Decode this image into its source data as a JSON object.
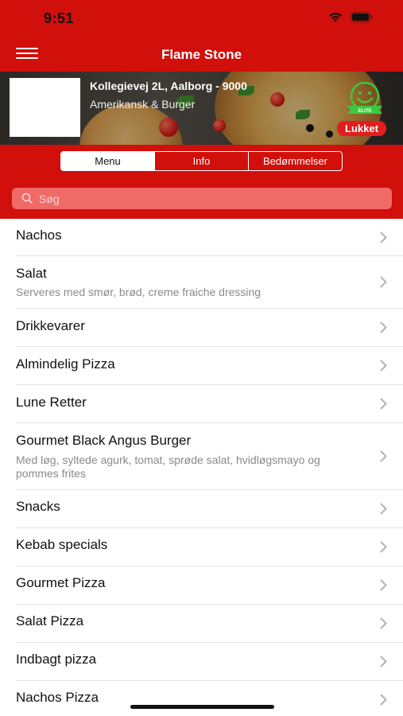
{
  "status_bar": {
    "time": "9:51"
  },
  "nav": {
    "title": "Flame Stone"
  },
  "restaurant": {
    "address": "Kollegievej 2L, Aalborg - 9000",
    "cuisine": "Amerikansk & Burger",
    "status": "Lukket",
    "smiley_label": "ELITE"
  },
  "tabs": [
    {
      "label": "Menu",
      "active": true
    },
    {
      "label": "Info",
      "active": false
    },
    {
      "label": "Bedømmelser",
      "active": false
    }
  ],
  "search": {
    "placeholder": "Søg",
    "value": ""
  },
  "menu": [
    {
      "title": "Nachos",
      "subtitle": ""
    },
    {
      "title": "Salat",
      "subtitle": "Serveres med smør, brød, creme fraiche dressing"
    },
    {
      "title": "Drikkevarer",
      "subtitle": ""
    },
    {
      "title": "Almindelig Pizza",
      "subtitle": ""
    },
    {
      "title": "Lune Retter",
      "subtitle": ""
    },
    {
      "title": "Gourmet Black Angus Burger",
      "subtitle": "Med løg, syltede agurk, tomat, sprøde salat, hvidløgsmayo og pommes frites"
    },
    {
      "title": "Snacks",
      "subtitle": ""
    },
    {
      "title": "Kebab specials",
      "subtitle": ""
    },
    {
      "title": "Gourmet Pizza",
      "subtitle": ""
    },
    {
      "title": "Salat Pizza",
      "subtitle": ""
    },
    {
      "title": "Indbagt pizza",
      "subtitle": ""
    },
    {
      "title": "Nachos Pizza",
      "subtitle": ""
    }
  ],
  "colors": {
    "brand_red": "#d10f0b",
    "badge_red": "#e11d1d",
    "smiley_green": "#3cc93c"
  },
  "icons": [
    "hamburger-menu-icon",
    "wifi-icon",
    "battery-icon",
    "smiley-icon",
    "search-icon",
    "chevron-right-icon"
  ]
}
